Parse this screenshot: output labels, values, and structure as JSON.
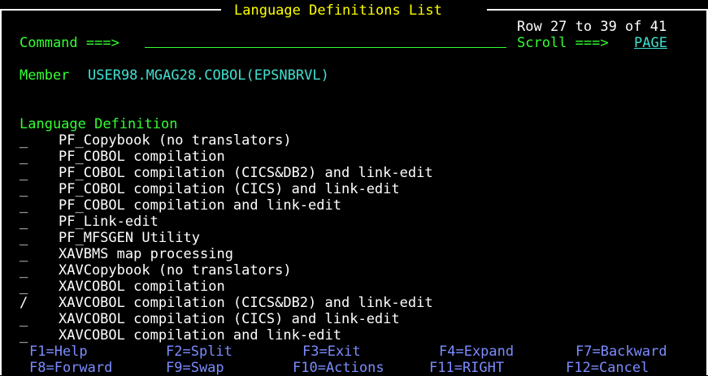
{
  "title": "Language Definitions List",
  "row_info": "Row 27 to 39 of 41",
  "command": {
    "label": "Command ===>",
    "value": ""
  },
  "scroll": {
    "label": "Scroll ===>",
    "value": "PAGE"
  },
  "member": {
    "label": "Member",
    "value": "USER98.MGAG28.COBOL(EPSNBRVL)"
  },
  "list_header": "Language Definition",
  "items": [
    {
      "sel": "_",
      "name": "PF_Copybook (no translators)"
    },
    {
      "sel": "_",
      "name": "PF_COBOL compilation"
    },
    {
      "sel": "_",
      "name": "PF_COBOL compilation (CICS&DB2) and link-edit"
    },
    {
      "sel": "_",
      "name": "PF_COBOL compilation (CICS) and link-edit"
    },
    {
      "sel": "_",
      "name": "PF_COBOL compilation and link-edit"
    },
    {
      "sel": "_",
      "name": "PF_Link-edit"
    },
    {
      "sel": "_",
      "name": "PF_MFSGEN Utility"
    },
    {
      "sel": "_",
      "name": "XAVBMS map processing"
    },
    {
      "sel": "_",
      "name": "XAVCopybook (no translators)"
    },
    {
      "sel": "_",
      "name": "XAVCOBOL compilation"
    },
    {
      "sel": "/",
      "name": "XAVCOBOL compilation (CICS&DB2) and link-edit"
    },
    {
      "sel": "_",
      "name": "XAVCOBOL compilation (CICS) and link-edit"
    },
    {
      "sel": "_",
      "name": "XAVCOBOL compilation and link-edit"
    }
  ],
  "fkeys_row1": [
    "F1=Help",
    "F2=Split",
    "F3=Exit",
    "F4=Expand",
    "F7=Backward"
  ],
  "fkeys_row2": [
    "F8=Forward",
    "F9=Swap",
    "F10=Actions",
    "F11=RIGHT",
    "F12=Cancel"
  ]
}
